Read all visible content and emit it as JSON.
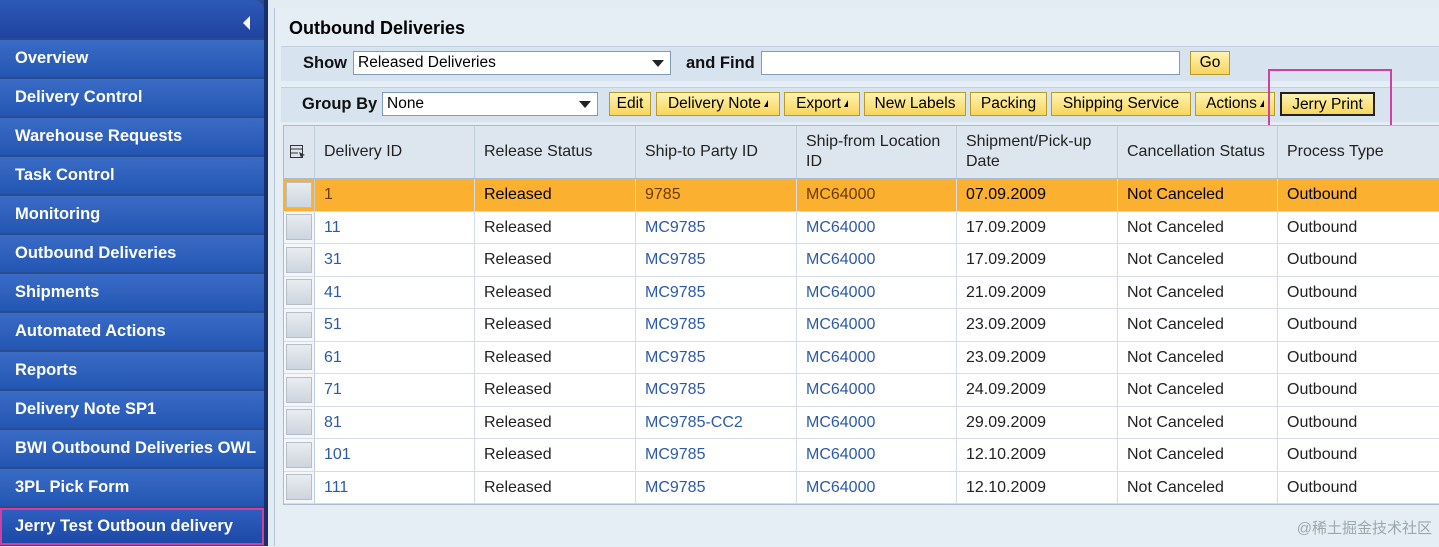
{
  "sidebar": {
    "items": [
      {
        "label": "Overview"
      },
      {
        "label": "Delivery Control"
      },
      {
        "label": "Warehouse Requests"
      },
      {
        "label": "Task Control"
      },
      {
        "label": "Monitoring"
      },
      {
        "label": "Outbound Deliveries"
      },
      {
        "label": "Shipments"
      },
      {
        "label": "Automated Actions"
      },
      {
        "label": "Reports"
      },
      {
        "label": "Delivery Note SP1"
      },
      {
        "label": "BWI Outbound Deliveries OWL"
      },
      {
        "label": "3PL Pick Form"
      },
      {
        "label": "Jerry Test Outboun delivery"
      }
    ],
    "collapse_icon": "collapse-left-icon"
  },
  "main": {
    "title": "Outbound Deliveries",
    "show_label": "Show",
    "show_value": "Released Deliveries",
    "find_label": "and Find",
    "find_value": "",
    "go_label": "Go",
    "group_by_label": "Group By",
    "group_by_value": "None",
    "buttons": {
      "edit": "Edit",
      "delivery_note": "Delivery Note",
      "export": "Export",
      "new_labels": "New Labels",
      "packing": "Packing",
      "shipping_service": "Shipping Service",
      "actions": "Actions",
      "jerry_print": "Jerry Print"
    }
  },
  "table": {
    "columns": [
      "Delivery ID",
      "Release Status",
      "Ship-to Party ID",
      "Ship-from Location ID",
      "Shipment/Pick-up Date",
      "Cancellation Status",
      "Process Type"
    ],
    "rows": [
      [
        "1",
        "Released",
        "9785",
        "MC64000",
        "07.09.2009",
        "Not Canceled",
        "Outbound"
      ],
      [
        "11",
        "Released",
        "MC9785",
        "MC64000",
        "17.09.2009",
        "Not Canceled",
        "Outbound"
      ],
      [
        "31",
        "Released",
        "MC9785",
        "MC64000",
        "17.09.2009",
        "Not Canceled",
        "Outbound"
      ],
      [
        "41",
        "Released",
        "MC9785",
        "MC64000",
        "21.09.2009",
        "Not Canceled",
        "Outbound"
      ],
      [
        "51",
        "Released",
        "MC9785",
        "MC64000",
        "23.09.2009",
        "Not Canceled",
        "Outbound"
      ],
      [
        "61",
        "Released",
        "MC9785",
        "MC64000",
        "23.09.2009",
        "Not Canceled",
        "Outbound"
      ],
      [
        "71",
        "Released",
        "MC9785",
        "MC64000",
        "24.09.2009",
        "Not Canceled",
        "Outbound"
      ],
      [
        "81",
        "Released",
        "MC9785-CC2",
        "MC64000",
        "29.09.2009",
        "Not Canceled",
        "Outbound"
      ],
      [
        "101",
        "Released",
        "MC9785",
        "MC64000",
        "12.10.2009",
        "Not Canceled",
        "Outbound"
      ],
      [
        "111",
        "Released",
        "MC9785",
        "MC64000",
        "12.10.2009",
        "Not Canceled",
        "Outbound"
      ]
    ],
    "selected_row": 0
  },
  "watermark": "@稀土掘金技术社区",
  "colors": {
    "sidebar": "#2356b3",
    "highlight": "#d23fa3",
    "selected_row": "#fbb030",
    "button": "#f7d65e",
    "link": "#2c5aa8"
  }
}
